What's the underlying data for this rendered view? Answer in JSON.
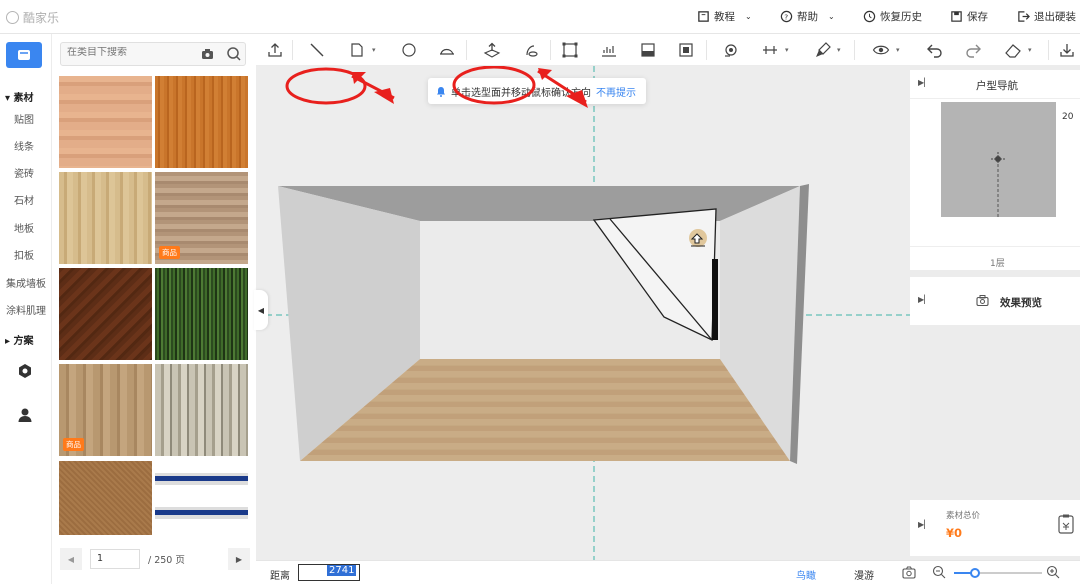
{
  "app": {
    "logo_text": "酷家乐"
  },
  "topnav": {
    "tutorial": "教程",
    "help": "帮助",
    "restore": "恢复历史",
    "save": "保存",
    "exit": "退出硬装"
  },
  "sidebar": {
    "materials_header": "素材",
    "items": [
      "贴图",
      "线条",
      "瓷砖",
      "石材",
      "地板",
      "扣板",
      "集成墙板",
      "涂料肌理"
    ],
    "plans_header": "方案"
  },
  "library": {
    "search_placeholder": "在类目下搜索",
    "badge": "商品",
    "page_current": "1",
    "page_total": "/ 250 页"
  },
  "tip": {
    "message": "单击选型面并移动鼠标确认方向",
    "dismiss": "不再提示"
  },
  "right": {
    "nav_title": "户型导航",
    "scale_text": "20",
    "floor_label": "1层",
    "preview_label": "效果预览",
    "total_label": "素材总价",
    "total_value": "¥0"
  },
  "bottom": {
    "distance_label": "距离",
    "distance_value": "2741",
    "bird_view": "鸟瞰",
    "roam": "漫游"
  },
  "colors": {
    "accent": "#3a86f0",
    "price": "#ff7a1a",
    "annotation": "#e8201d"
  }
}
